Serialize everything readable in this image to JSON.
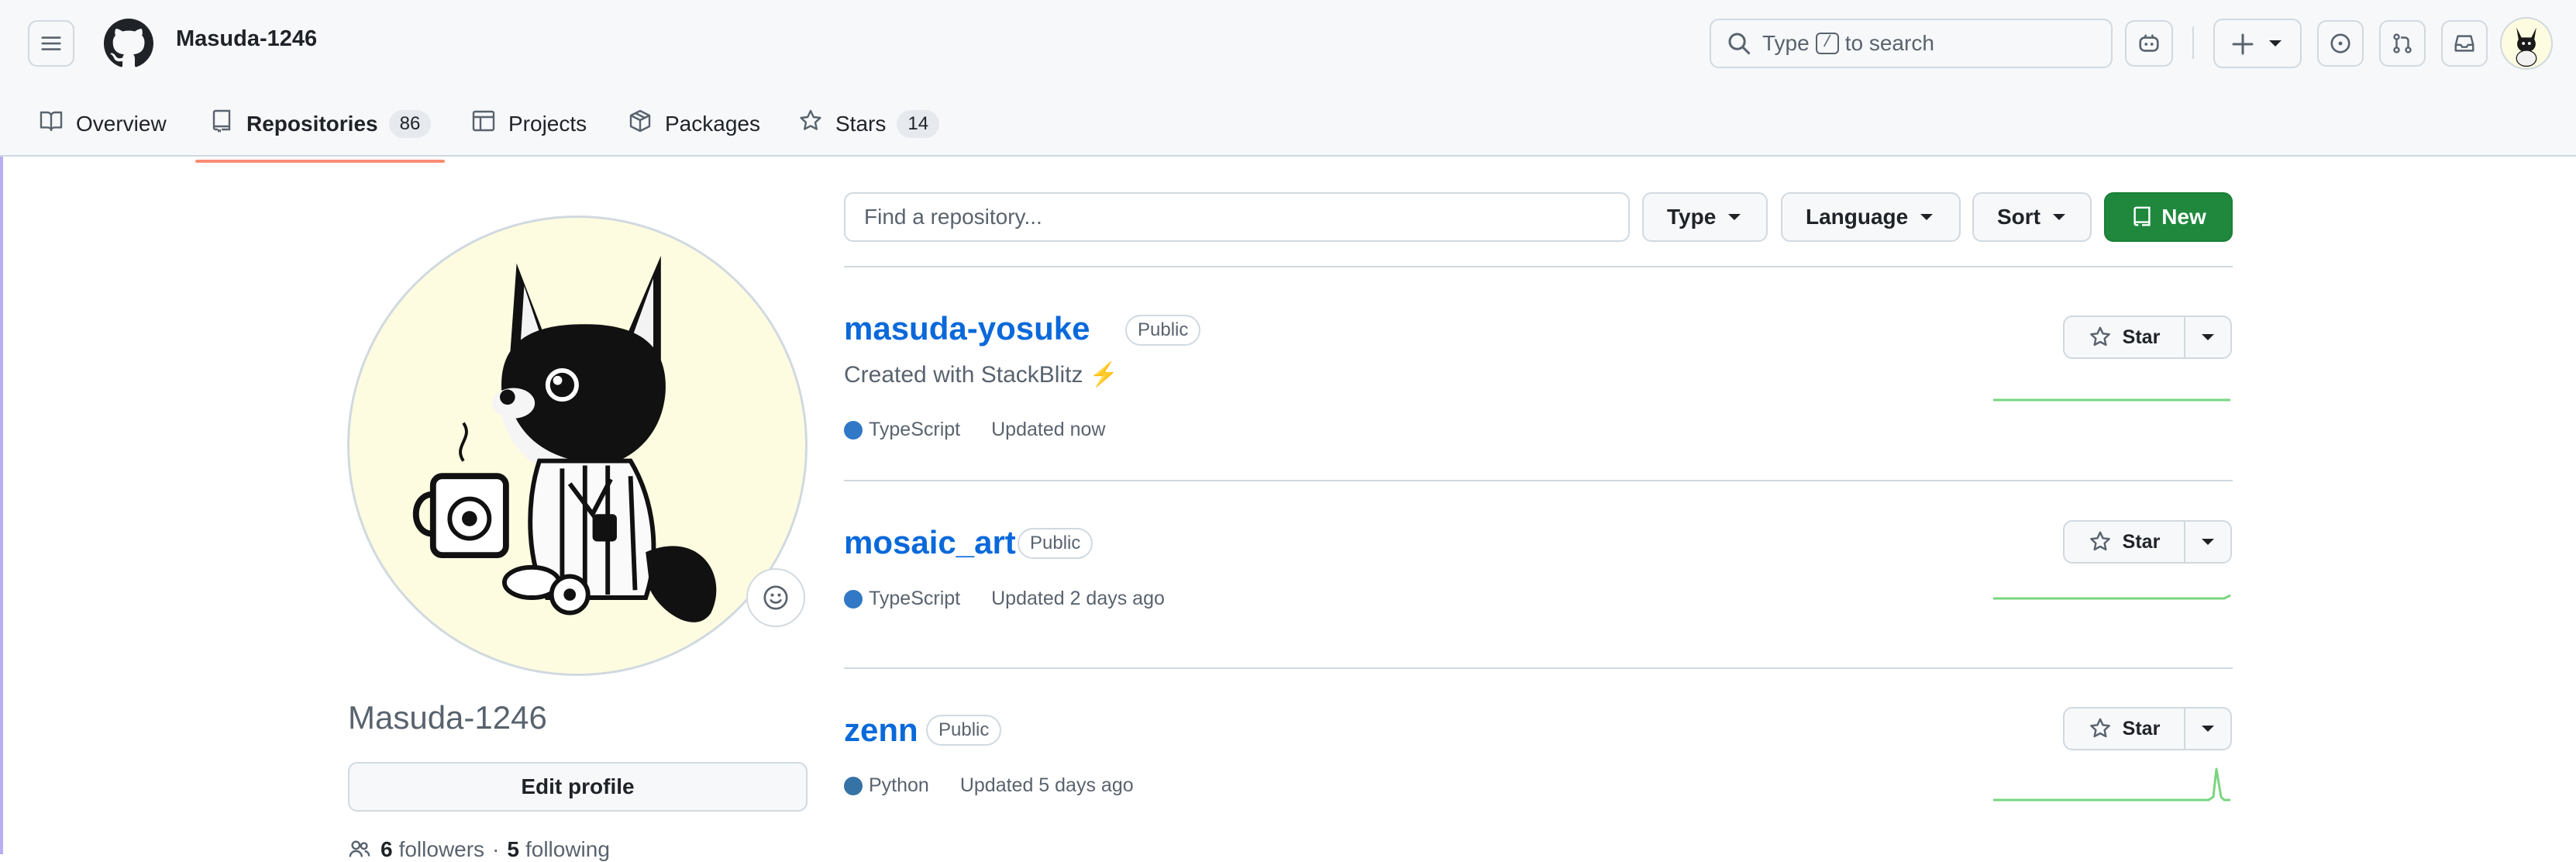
{
  "header": {
    "owner": "Masuda-1246",
    "search": {
      "prefix": "Type",
      "key": "/",
      "suffix": "to search"
    }
  },
  "tabs": [
    {
      "label": "Overview",
      "icon": "book-icon"
    },
    {
      "label": "Repositories",
      "count": "86",
      "icon": "repo-icon",
      "active": true
    },
    {
      "label": "Projects",
      "icon": "table-icon"
    },
    {
      "label": "Packages",
      "icon": "package-icon"
    },
    {
      "label": "Stars",
      "count": "14",
      "icon": "star-icon"
    }
  ],
  "profile": {
    "name": "Masuda-1246",
    "edit_label": "Edit profile",
    "followers": "6",
    "followers_label": "followers",
    "following": "5",
    "following_label": "following"
  },
  "filters": {
    "placeholder": "Find a repository...",
    "type_label": "Type",
    "language_label": "Language",
    "sort_label": "Sort",
    "new_label": "New"
  },
  "repos": [
    {
      "name": "masuda-yosuke",
      "visibility": "Public",
      "description": "Created with StackBlitz ⚡️",
      "language": "TypeScript",
      "language_color": "#3178c6",
      "updated": "Updated now",
      "star_label": "Star"
    },
    {
      "name": "mosaic_art",
      "visibility": "Public",
      "language": "TypeScript",
      "language_color": "#3178c6",
      "updated": "Updated 2 days ago",
      "star_label": "Star"
    },
    {
      "name": "zenn",
      "visibility": "Public",
      "language": "Python",
      "language_color": "#3572A5",
      "updated": "Updated 5 days ago",
      "star_label": "Star"
    }
  ],
  "colors": {
    "accent": "#1f883d",
    "link": "#0969da",
    "tab_underline": "#fd8c73"
  }
}
